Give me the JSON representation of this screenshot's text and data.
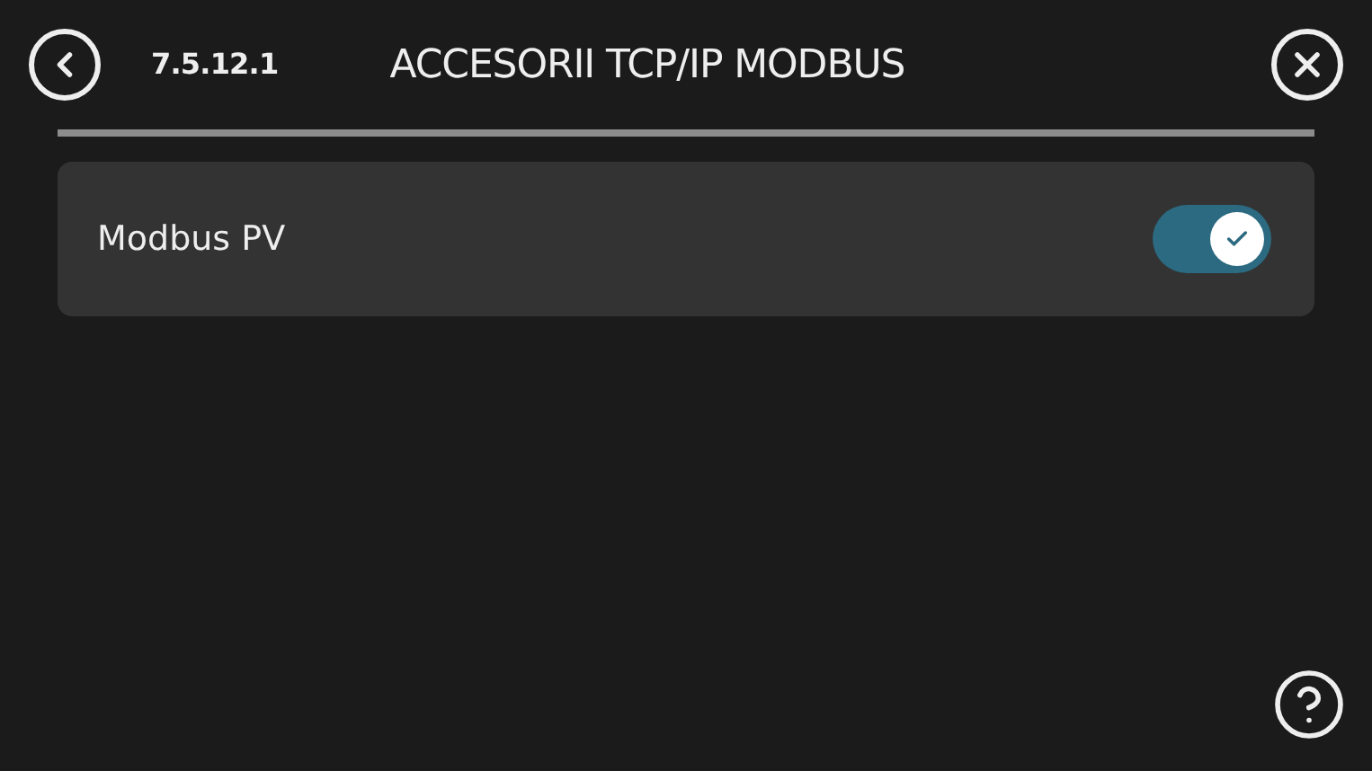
{
  "header": {
    "code": "7.5.12.1",
    "title": "ACCESORII TCP/IP MODBUS"
  },
  "settings": [
    {
      "label": "Modbus PV",
      "on": true
    }
  ]
}
